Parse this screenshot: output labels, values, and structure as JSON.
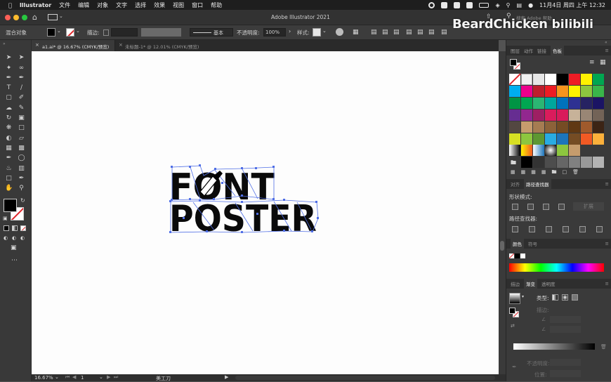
{
  "menubar": {
    "app": "Illustrator",
    "items": [
      "文件",
      "编辑",
      "对象",
      "文字",
      "选择",
      "效果",
      "视图",
      "窗口",
      "帮助"
    ],
    "clock": "11月4日 周四 上午 12:32"
  },
  "titlebar": {
    "title": "Adobe Illustrator 2021",
    "search_placeholder": "搜索 Adobe 帮助",
    "workspace": "支持"
  },
  "controlbar": {
    "selection": "混合对象",
    "stroke_label": "描边:",
    "stroke_style": "基本",
    "opacity_label": "不透明度:",
    "opacity_value": "100%",
    "style_label": "样式:"
  },
  "tabs": [
    {
      "label": "a1.ai* @ 16.67% (CMYK/预览)",
      "active": true
    },
    {
      "label": "未标题-1* @ 12.01% (CMYK/预览)",
      "active": false
    }
  ],
  "artwork": {
    "line1": "FONT",
    "line2": "POSTER"
  },
  "statusbar": {
    "zoom": "16.67%",
    "page": "1",
    "tool": "美工刀"
  },
  "watermark": {
    "text": "BeardChicken",
    "logo": "bilibili"
  },
  "panels": {
    "top_tabs": [
      "图层",
      "动作",
      "链接",
      "色板"
    ],
    "pathfinder_tabs": [
      "对齐",
      "路径查找器"
    ],
    "shape_modes_label": "形状模式:",
    "expand_label": "扩展",
    "pathfinders_label": "路径查找器:",
    "color_tabs": [
      "颜色",
      "符号"
    ],
    "gradient_tabs": [
      "描边",
      "渐变",
      "透明度"
    ],
    "type_label": "类型:",
    "stroke_label": "描边:",
    "opacity_label": "不透明度:",
    "position_label": "位置:"
  },
  "colors": {
    "accent": "#4f6ee6",
    "menubar": "#1e1e1e",
    "panel_bg": "#3a3a3a"
  },
  "swatches": [
    [
      "#ffffff",
      "#ffffff",
      "#e6e6e6",
      "#ffffff",
      "#000000",
      "#ee1c25",
      "#fff200",
      "#00a651"
    ],
    [
      "#00aeef",
      "#ec008c",
      "#be1e2d",
      "#ed1c24",
      "#f7941d",
      "#fff200",
      "#8dc63f",
      "#39b54a"
    ],
    [
      "#009444",
      "#00a651",
      "#2bb673",
      "#00a79d",
      "#0072bc",
      "#2e3192",
      "#262262",
      "#1b1464"
    ],
    [
      "#662d91",
      "#92278f",
      "#9e1f63",
      "#da1c5c",
      "#d91b5b",
      "#c7b299",
      "#998675",
      "#736357"
    ],
    [
      "#534741",
      "#c69c6d",
      "#a67c52",
      "#8c6239",
      "#754c24",
      "#603813",
      "#a05a2c",
      "#3c2415"
    ],
    [
      "#d7df23",
      "#8dc63f",
      "#5d9732",
      "#29abe2",
      "#1c75bc",
      "#754c24",
      "#f15a24",
      "#fbb03b"
    ]
  ]
}
